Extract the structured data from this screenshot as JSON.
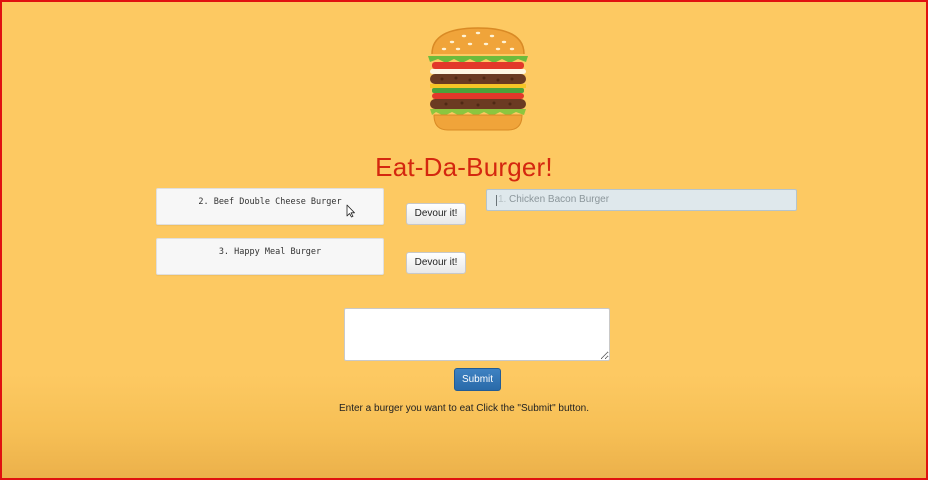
{
  "app": {
    "title": "Eat-Da-Burger!",
    "logo_icon": "hamburger-icon"
  },
  "burgers": [
    {
      "label": "2. Beef Double Cheese Burger",
      "button": "Devour it!"
    },
    {
      "label": "3. Happy Meal Burger",
      "button": "Devour it!"
    }
  ],
  "devoured": [
    {
      "number": "1.",
      "label": "Chicken Bacon Burger"
    }
  ],
  "form": {
    "textarea_value": "",
    "submit_label": "Submit",
    "instructions": "Enter a burger you want to eat Click the \"Submit\" button."
  },
  "colors": {
    "background": "#fdc962",
    "title": "#d4270f",
    "submit_button": "#2f74b5",
    "frame_border": "#e01010"
  }
}
